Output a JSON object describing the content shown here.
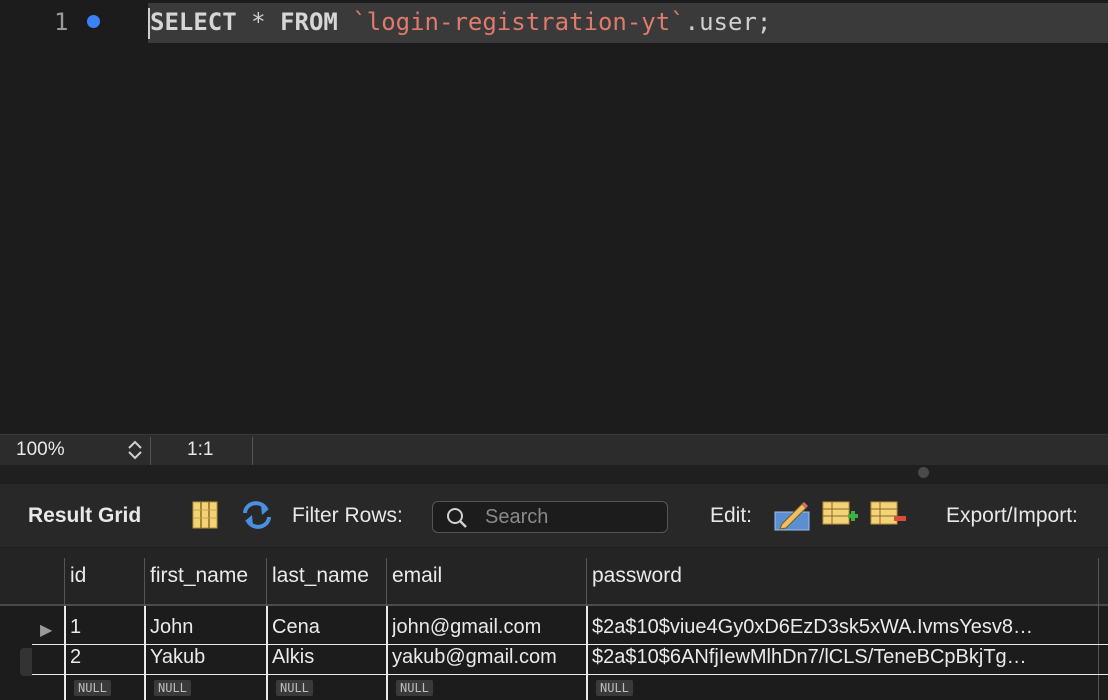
{
  "editor": {
    "line_number": "1",
    "sql": {
      "kw1": "SELECT",
      "star": " * ",
      "kw2": "FROM",
      "space": " ",
      "schema": "`login-registration-yt`",
      "table": ".user;"
    }
  },
  "status": {
    "zoom": "100%",
    "position": "1:1"
  },
  "toolbar": {
    "title": "Result Grid",
    "filter_label": "Filter Rows:",
    "search_placeholder": "Search",
    "edit_label": "Edit:",
    "export_label": "Export/Import:"
  },
  "grid": {
    "columns": [
      "id",
      "first_name",
      "last_name",
      "email",
      "password"
    ],
    "rows": [
      [
        "1",
        "John",
        "Cena",
        "john@gmail.com",
        "$2a$10$viue4Gy0xD6EzD3sk5xWA.IvmsYesv8…"
      ],
      [
        "2",
        "Yakub",
        "Alkis",
        "yakub@gmail.com",
        "$2a$10$6ANfjIewMlhDn7/lCLS/TeneBCpBkjTg…"
      ]
    ],
    "null_label": "NULL"
  },
  "colors": {
    "accent": "#3b82f6",
    "string": "#e07a6a",
    "background": "#1c1c1c"
  }
}
